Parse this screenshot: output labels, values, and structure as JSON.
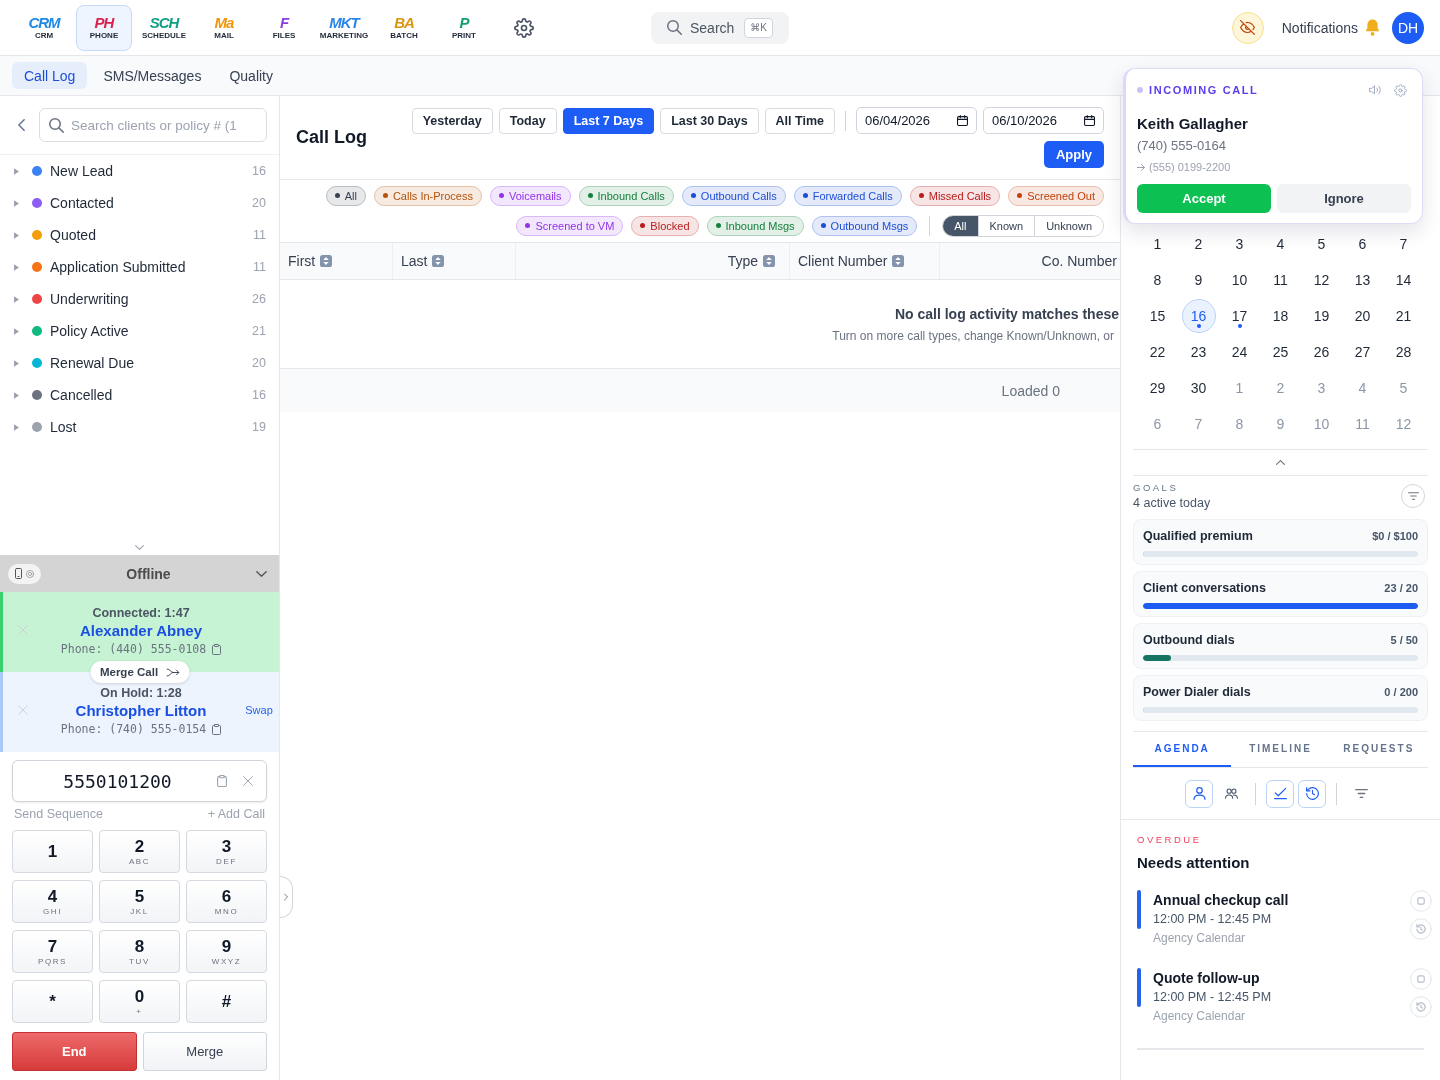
{
  "top_bar": {
    "apps": [
      {
        "logo": "CRM",
        "label": "CRM",
        "color": "#1f8ae6",
        "selected": false
      },
      {
        "logo": "PH",
        "label": "PHONE",
        "color": "#d9234f",
        "selected": true
      },
      {
        "logo": "SCH",
        "label": "SCHEDULE",
        "color": "#0f9f85",
        "selected": false
      },
      {
        "logo": "Ma",
        "label": "MAIL",
        "color": "#f0960e",
        "selected": false
      },
      {
        "logo": "F",
        "label": "FILES",
        "color": "#8a3ee0",
        "selected": false
      },
      {
        "logo": "MKT",
        "label": "MARKETING",
        "color": "#2b86e8",
        "selected": false
      },
      {
        "logo": "BA",
        "label": "BATCH",
        "color": "#d9960f",
        "selected": false
      },
      {
        "logo": "P",
        "label": "PRINT",
        "color": "#12a070",
        "selected": false
      }
    ],
    "search": {
      "label": "Search",
      "shortcut": "⌘K"
    },
    "notifications": "Notifications",
    "avatar": "DH"
  },
  "tabs": [
    {
      "label": "Call Log",
      "selected": true
    },
    {
      "label": "SMS/Messages",
      "selected": false
    },
    {
      "label": "Quality",
      "selected": false
    }
  ],
  "sidebar": {
    "search": {
      "placeholder": "Search clients or policy # (1"
    },
    "stages": [
      {
        "label": "New Lead",
        "count": "16",
        "color": "#3b82f6"
      },
      {
        "label": "Contacted",
        "count": "20",
        "color": "#8b5cf6"
      },
      {
        "label": "Quoted",
        "count": "11",
        "color": "#f59e0b"
      },
      {
        "label": "Application Submitted",
        "count": "11",
        "color": "#f97316"
      },
      {
        "label": "Underwriting",
        "count": "26",
        "color": "#ef4444"
      },
      {
        "label": "Policy Active",
        "count": "21",
        "color": "#10b981"
      },
      {
        "label": "Renewal Due",
        "count": "20",
        "color": "#06b6d4"
      },
      {
        "label": "Cancelled",
        "count": "16",
        "color": "#6b7280"
      },
      {
        "label": "Lost",
        "count": "19",
        "color": "#9ca3af"
      }
    ]
  },
  "phone": {
    "status": "Offline",
    "calls": [
      {
        "kind": "connected",
        "status": "Connected: 1:47",
        "name": "Alexander Abney",
        "phone": "Phone: (440) 555-0108"
      },
      {
        "kind": "on_hold",
        "status": "On Hold: 1:28",
        "name": "Christopher Litton",
        "phone": "Phone: (740) 555-0154",
        "action": "Swap"
      }
    ],
    "merge_call": "Merge Call",
    "dial": {
      "value": "5550101200"
    },
    "send_sequence": "Send Sequence",
    "add_call": "+ Add Call",
    "keys": [
      {
        "digit": "1"
      },
      {
        "digit": "2",
        "letters": "ABC"
      },
      {
        "digit": "3",
        "letters": "DEF"
      },
      {
        "digit": "4",
        "letters": "GHI"
      },
      {
        "digit": "5",
        "letters": "JKL"
      },
      {
        "digit": "6",
        "letters": "MNO"
      },
      {
        "digit": "7",
        "letters": "PQRS"
      },
      {
        "digit": "8",
        "letters": "TUV"
      },
      {
        "digit": "9",
        "letters": "WXYZ"
      },
      {
        "digit": "*"
      },
      {
        "digit": "0",
        "letters": "+"
      },
      {
        "digit": "#"
      }
    ],
    "end": "End",
    "merge": "Merge"
  },
  "call_log": {
    "title": "Call Log",
    "ranges": [
      {
        "label": "Yesterday",
        "selected": false
      },
      {
        "label": "Today",
        "selected": false
      },
      {
        "label": "Last 7 Days",
        "selected": true
      },
      {
        "label": "Last 30 Days",
        "selected": false
      },
      {
        "label": "All Time",
        "selected": false
      }
    ],
    "date_from": "06/04/2026",
    "date_to": "06/10/2026",
    "apply": "Apply",
    "filter_rows": [
      [
        {
          "label": "All",
          "color": "#374151"
        },
        {
          "label": "Calls In-Process",
          "color": "#b45309"
        },
        {
          "label": "Voicemails",
          "color": "#9333ea"
        },
        {
          "label": "Inbound Calls",
          "color": "#15803d"
        },
        {
          "label": "Outbound Calls",
          "color": "#1d4ed8"
        },
        {
          "label": "Forwarded Calls",
          "color": "#1d4ed8"
        },
        {
          "label": "Missed Calls",
          "color": "#b91c1c"
        },
        {
          "label": "Screened Out",
          "color": "#c2410c"
        }
      ],
      [
        {
          "label": "Screened to VM",
          "color": "#9333ea"
        },
        {
          "label": "Blocked",
          "color": "#b91c1c"
        },
        {
          "label": "Inbound Msgs",
          "color": "#15803d"
        },
        {
          "label": "Outbound Msgs",
          "color": "#1d4ed8"
        }
      ]
    ],
    "contact_filter": [
      {
        "label": "All",
        "selected": true
      },
      {
        "label": "Known",
        "selected": false
      },
      {
        "label": "Unknown",
        "selected": false
      }
    ],
    "columns": [
      {
        "label": "First",
        "sortable": true
      },
      {
        "label": "Last",
        "sortable": true
      },
      {
        "label": "Type",
        "sortable": true
      },
      {
        "label": "Client Number",
        "sortable": true
      },
      {
        "label": "Co. Number",
        "sortable": false
      }
    ],
    "empty": {
      "title": "No call log activity matches these",
      "hint": "Turn on more call types, change Known/Unknown, or"
    },
    "footer": "Loaded 0"
  },
  "incoming_call": {
    "label": "INCOMING CALL",
    "name": "Keith Gallagher",
    "number": "(740) 555-0164",
    "forwarded_to": "(555) 0199-2200",
    "accept": "Accept",
    "ignore": "Ignore"
  },
  "calendar": {
    "days": [
      {
        "label": "1",
        "other_month": false,
        "selected": false,
        "event": false
      },
      {
        "label": "2",
        "other_month": false,
        "selected": false,
        "event": false
      },
      {
        "label": "3",
        "other_month": false,
        "selected": false,
        "event": false
      },
      {
        "label": "4",
        "other_month": false,
        "selected": false,
        "event": false
      },
      {
        "label": "5",
        "other_month": false,
        "selected": false,
        "event": false
      },
      {
        "label": "6",
        "other_month": false,
        "selected": false,
        "event": false
      },
      {
        "label": "7",
        "other_month": false,
        "selected": false,
        "event": false
      },
      {
        "label": "8",
        "other_month": false,
        "selected": false,
        "event": false
      },
      {
        "label": "9",
        "other_month": false,
        "selected": false,
        "event": false
      },
      {
        "label": "10",
        "other_month": false,
        "selected": false,
        "event": false
      },
      {
        "label": "11",
        "other_month": false,
        "selected": false,
        "event": false
      },
      {
        "label": "12",
        "other_month": false,
        "selected": false,
        "event": false
      },
      {
        "label": "13",
        "other_month": false,
        "selected": false,
        "event": false
      },
      {
        "label": "14",
        "other_month": false,
        "selected": false,
        "event": false
      },
      {
        "label": "15",
        "other_month": false,
        "selected": false,
        "event": false
      },
      {
        "label": "16",
        "other_month": false,
        "selected": true,
        "event": true
      },
      {
        "label": "17",
        "other_month": false,
        "selected": false,
        "event": true
      },
      {
        "label": "18",
        "other_month": false,
        "selected": false,
        "event": false
      },
      {
        "label": "19",
        "other_month": false,
        "selected": false,
        "event": false
      },
      {
        "label": "20",
        "other_month": false,
        "selected": false,
        "event": false
      },
      {
        "label": "21",
        "other_month": false,
        "selected": false,
        "event": false
      },
      {
        "label": "22",
        "other_month": false,
        "selected": false,
        "event": false
      },
      {
        "label": "23",
        "other_month": false,
        "selected": false,
        "event": false
      },
      {
        "label": "24",
        "other_month": false,
        "selected": false,
        "event": false
      },
      {
        "label": "25",
        "other_month": false,
        "selected": false,
        "event": false
      },
      {
        "label": "26",
        "other_month": false,
        "selected": false,
        "event": false
      },
      {
        "label": "27",
        "other_month": false,
        "selected": false,
        "event": false
      },
      {
        "label": "28",
        "other_month": false,
        "selected": false,
        "event": false
      },
      {
        "label": "29",
        "other_month": false,
        "selected": false,
        "event": false
      },
      {
        "label": "30",
        "other_month": false,
        "selected": false,
        "event": false
      },
      {
        "label": "1",
        "other_month": true,
        "selected": false,
        "event": false
      },
      {
        "label": "2",
        "other_month": true,
        "selected": false,
        "event": false
      },
      {
        "label": "3",
        "other_month": true,
        "selected": false,
        "event": false
      },
      {
        "label": "4",
        "other_month": true,
        "selected": false,
        "event": false
      },
      {
        "label": "5",
        "other_month": true,
        "selected": false,
        "event": false
      },
      {
        "label": "6",
        "other_month": true,
        "selected": false,
        "event": false
      },
      {
        "label": "7",
        "other_month": true,
        "selected": false,
        "event": false
      },
      {
        "label": "8",
        "other_month": true,
        "selected": false,
        "event": false
      },
      {
        "label": "9",
        "other_month": true,
        "selected": false,
        "event": false
      },
      {
        "label": "10",
        "other_month": true,
        "selected": false,
        "event": false
      },
      {
        "label": "11",
        "other_month": true,
        "selected": false,
        "event": false
      },
      {
        "label": "12",
        "other_month": true,
        "selected": false,
        "event": false
      }
    ]
  },
  "goals": {
    "heading": "GOALS",
    "summary": "4 active today",
    "items": [
      {
        "label": "Qualified premium",
        "reading": "$0 / $100",
        "level": 0
      },
      {
        "label": "Client conversations",
        "reading": "23 / 20",
        "level": 1,
        "color": "#1d5cf0"
      },
      {
        "label": "Outbound dials",
        "reading": "5 / 50",
        "level": 0.1,
        "color": "#137562"
      },
      {
        "label": "Power Dialer dials",
        "reading": "0 / 200",
        "level": 0
      }
    ]
  },
  "agenda": {
    "tabs": [
      {
        "label": "AGENDA",
        "selected": true
      },
      {
        "label": "TIMELINE",
        "selected": false
      },
      {
        "label": "REQUESTS",
        "selected": false
      }
    ],
    "toggle_groups": [
      [
        {
          "kind": "person",
          "on": true
        },
        {
          "kind": "people",
          "on": false
        }
      ],
      [
        {
          "kind": "check",
          "on": true
        },
        {
          "kind": "history",
          "on": true
        }
      ]
    ],
    "section": "OVERDUE",
    "title": "Needs attention",
    "items": [
      {
        "title": "Annual checkup call",
        "time": "12:00 PM - 12:45 PM",
        "calendar": "Agency Calendar"
      },
      {
        "title": "Quote follow-up",
        "time": "12:00 PM - 12:45 PM",
        "calendar": "Agency Calendar"
      }
    ]
  }
}
